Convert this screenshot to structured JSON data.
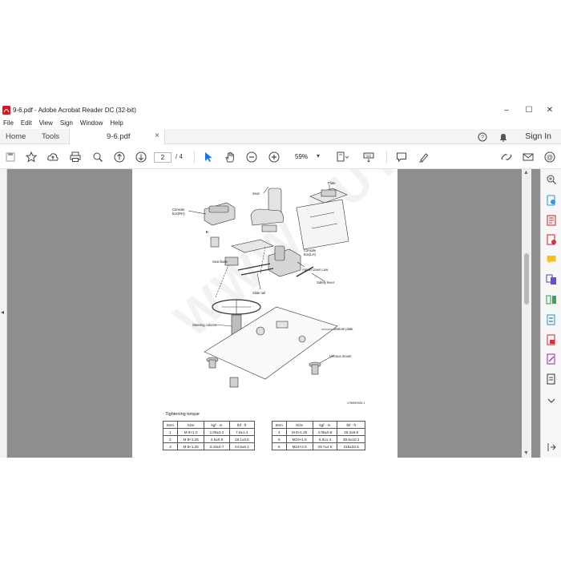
{
  "app": {
    "title": "9-6.pdf - Adobe Acrobat Reader DC (32-bit)",
    "controls": {
      "minimize": "–",
      "maximize": "☐",
      "close": "✕"
    }
  },
  "menu": [
    "File",
    "Edit",
    "View",
    "Sign",
    "Window",
    "Help"
  ],
  "tabs": {
    "home": "Home",
    "tools": "Tools",
    "document": "9-6.pdf",
    "close": "×",
    "sign_in": "Sign In"
  },
  "toolbar": {
    "page_current": "2",
    "page_total": "/ 4",
    "zoom": "59%",
    "zoom_arrow": "▾"
  },
  "scroll": {
    "left_arrow": "◂",
    "up": "▲",
    "down": "▼"
  },
  "pdf": {
    "labels": {
      "seat": "Seat",
      "plate": "Plate",
      "console_rh": "Console\nbox(RH)",
      "console_lh": "Console\nbox(LH)",
      "k": "K",
      "seat_base": "Seat base",
      "aircon_cover": "Aircon cover Low",
      "safety_lever": "Safety lever",
      "slide_rail": "Slide rail",
      "steering_column": "Steering column",
      "bottom_plate": "Bottom plate",
      "viscous_mount": "Viscous mount",
      "figure_id": "17W99HOM-1"
    },
    "torque_title": "· Tightening torque",
    "table": {
      "headers": [
        "Item",
        "Size",
        "kgf · m",
        "lbf · ft"
      ],
      "left_rows": [
        [
          "1",
          "M 6×1.0",
          "1.05±0.2",
          "7.6±1.4"
        ],
        [
          "2",
          "M 8×1.25",
          "2.5±0.5",
          "18.1±3.6"
        ],
        [
          "3",
          "M 8×1.25",
          "3.43±0.7",
          "24.8±5.1"
        ]
      ],
      "right_rows": [
        [
          "4",
          "M 8×1.25",
          "4.05±0.8",
          "29.3±5.8"
        ],
        [
          "5",
          "M10×1.5",
          "6.9±1.4",
          "49.9±10.1"
        ],
        [
          "6",
          "M16×2.0",
          "29.7±4.5",
          "215±32.5"
        ]
      ]
    },
    "watermark": "WWW.AUTOEPO.COM"
  }
}
